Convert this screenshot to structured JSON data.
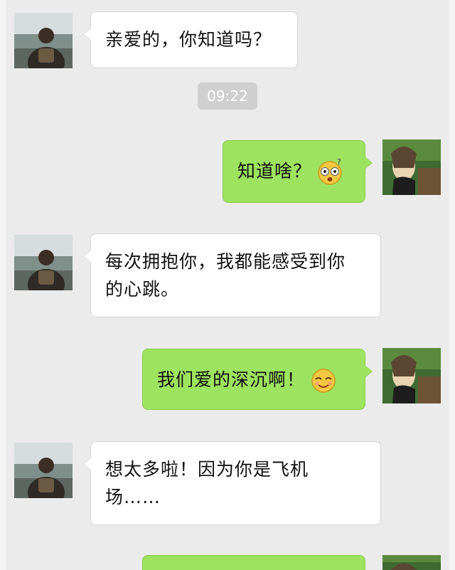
{
  "chat": {
    "timestamp": "09:22",
    "messages": [
      {
        "from": "other",
        "text": "亲爱的，你知道吗？"
      },
      {
        "from": "me",
        "text": "知道啥？",
        "emoji": "surprised-face-emoji"
      },
      {
        "from": "other",
        "line1": "每次拥抱你，我都能感受到你",
        "line2": "的心跳。"
      },
      {
        "from": "me",
        "text": "我们爱的深沉啊！",
        "emoji": "blissful-face-emoji"
      },
      {
        "from": "other",
        "line1": "想太多啦！因为你是飞机",
        "line2": "场……"
      },
      {
        "from": "me",
        "text": ""
      }
    ]
  },
  "colors": {
    "background": "#ebebeb",
    "incoming_bubble": "#ffffff",
    "outgoing_bubble": "#9de35f",
    "timestamp_badge": "#cfcfcf"
  }
}
